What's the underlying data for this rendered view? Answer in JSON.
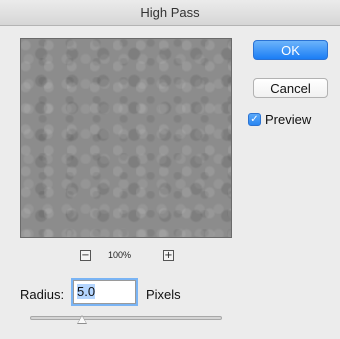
{
  "window": {
    "title": "High Pass"
  },
  "preview": {
    "zoom_out_symbol": "−",
    "zoom_in_symbol": "+",
    "zoom_level": "100%"
  },
  "buttons": {
    "ok_label": "OK",
    "cancel_label": "Cancel"
  },
  "preview_toggle": {
    "label": "Preview",
    "checked": true,
    "check_symbol": "✓"
  },
  "radius": {
    "label": "Radius:",
    "value": "5.0",
    "unit": "Pixels",
    "slider_fraction": 0.27
  },
  "colors": {
    "accent": "#1b7df5",
    "preview_gray": "#8c8c8c",
    "dialog_bg": "#ececec"
  }
}
